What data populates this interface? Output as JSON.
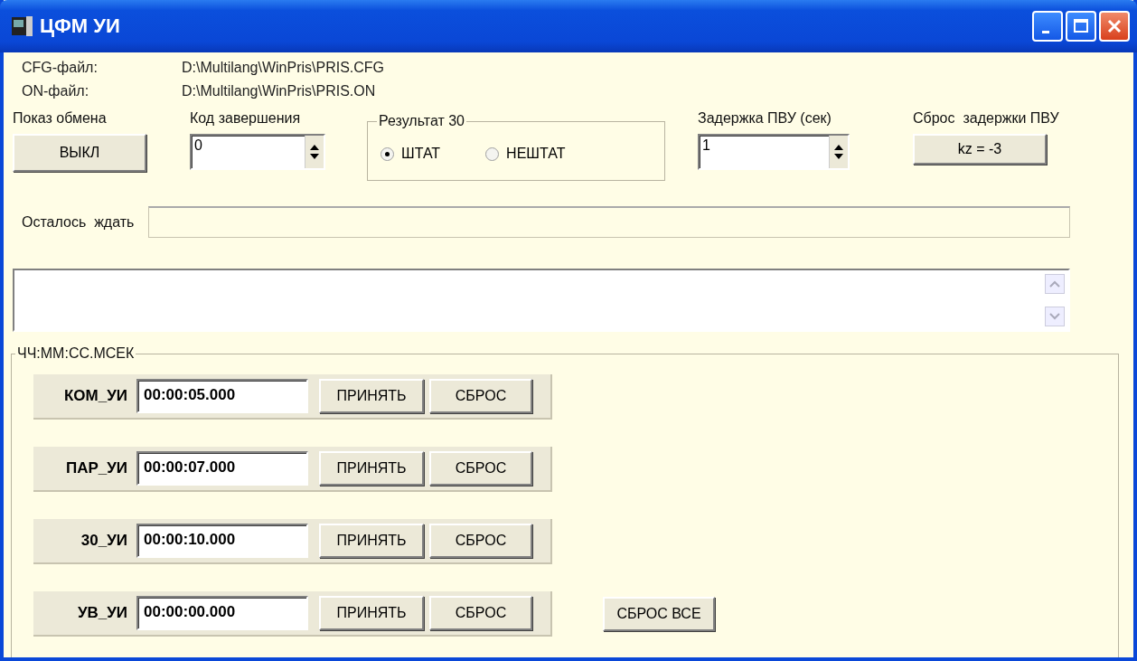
{
  "window": {
    "title": "ЦФМ УИ"
  },
  "files": [
    {
      "label": "CFG-файл:",
      "value": "D:\\Multilang\\WinPris\\PRIS.CFG"
    },
    {
      "label": "ON-файл:",
      "value": "D:\\Multilang\\WinPris\\PRIS.ON"
    }
  ],
  "show_exchange": {
    "label": "Показ обмена",
    "button": "ВЫКЛ"
  },
  "exit_code": {
    "label": "Код завершения",
    "value": "0"
  },
  "result_group": {
    "title": "Результат 30",
    "options": [
      {
        "label": "ШТАТ",
        "selected": true
      },
      {
        "label": "НЕШТАТ",
        "selected": false
      }
    ]
  },
  "pvu_delay": {
    "label": "Задержка ПВУ (сек)",
    "value": "1"
  },
  "pvu_reset": {
    "label": "Сброс  задержки ПВУ",
    "button": "kz = -3"
  },
  "remaining": {
    "label": "Осталось  ждать"
  },
  "time_group": {
    "title": "ЧЧ:ММ:СС.МСЕК",
    "rows": [
      {
        "name": "КОМ_УИ",
        "value": "00:00:05.000",
        "buttons": [
          "ПРИНЯТЬ",
          "СБРОС"
        ]
      },
      {
        "name": "ПАР_УИ",
        "value": "00:00:07.000",
        "buttons": [
          "ПРИНЯТЬ",
          "СБРОС"
        ]
      },
      {
        "name": "30_УИ",
        "value": "00:00:10.000",
        "buttons": [
          "ПРИНЯТЬ",
          "СБРОС"
        ]
      },
      {
        "name": "УВ_УИ",
        "value": "00:00:00.000",
        "buttons": [
          "ПРИНЯТЬ",
          "СБРОС"
        ]
      }
    ],
    "reset_all_button": "СБРОС ВСЕ"
  }
}
